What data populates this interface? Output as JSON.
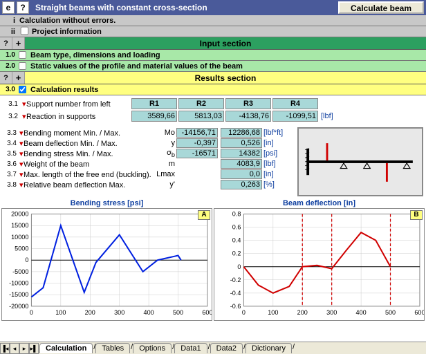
{
  "header": {
    "title": "Straight beams with constant cross-section",
    "calc_btn": "Calculate beam"
  },
  "info": {
    "i": "i",
    "i_text": "Calculation without errors.",
    "ii": "ii",
    "ii_text": "Project information"
  },
  "input_section": {
    "title": "Input section",
    "q": "?",
    "plus": "+"
  },
  "row10": {
    "num": "1.0",
    "text": "Beam type, dimensions and loading"
  },
  "row20": {
    "num": "2.0",
    "text": "Static values of the profile and material values of the beam"
  },
  "results_section": {
    "title": "Results section",
    "q": "?",
    "plus": "+"
  },
  "row30": {
    "num": "3.0",
    "text": "Calculation results"
  },
  "reactions": {
    "r31": "3.1",
    "r31_label": "Support number from left",
    "headers": [
      "R1",
      "R2",
      "R3",
      "R4"
    ],
    "r32": "3.2",
    "r32_label": "Reaction in supports",
    "values": [
      "3589,66",
      "5813,03",
      "-4138,76",
      "-1099,51"
    ],
    "unit": "[lbf]"
  },
  "calc": {
    "rows": [
      {
        "num": "3.3",
        "label": "Bending moment Min. / Max.",
        "sym": "Mo",
        "min": "-14156,71",
        "max": "12286,68",
        "unit": "[lbf*ft]"
      },
      {
        "num": "3.4",
        "label": "Beam deflection Min. / Max.",
        "sym": "y",
        "min": "-0,397",
        "max": "0,526",
        "unit": "[in]"
      },
      {
        "num": "3.5",
        "label": "Bending stress Min. / Max.",
        "sym": "σ<sub>b</sub>",
        "min": "-16571",
        "max": "14382",
        "unit": "[psi]"
      },
      {
        "num": "3.6",
        "label": "Weight of the beam",
        "sym": "m",
        "min": "",
        "max": "4083,9",
        "unit": "[lbf]"
      },
      {
        "num": "3.7",
        "label": "Max. length of the free end (buckling).",
        "sym": "Lmax",
        "min": "",
        "max": "0,0",
        "unit": "[in]"
      },
      {
        "num": "3.8",
        "label": "Relative beam deflection Max.",
        "sym": "y'",
        "min": "",
        "max": "0,263",
        "unit": "[%]"
      }
    ]
  },
  "chart_data": [
    {
      "type": "line",
      "title": "Bending stress  [psi]",
      "badge": "A",
      "xlim": [
        0,
        600
      ],
      "ylim": [
        -20000,
        20000
      ],
      "xticks": [
        0,
        100,
        200,
        300,
        400,
        500,
        600
      ],
      "yticks": [
        -20000,
        -15000,
        -10000,
        -5000,
        0,
        5000,
        10000,
        15000,
        20000
      ],
      "x": [
        0,
        40,
        100,
        180,
        220,
        300,
        380,
        430,
        500,
        510
      ],
      "y": [
        -16000,
        -12000,
        15000,
        -14000,
        -1000,
        11000,
        -5000,
        0,
        2000,
        0
      ],
      "color": "#0020e0"
    },
    {
      "type": "line",
      "title": "Beam deflection  [in]",
      "badge": "B",
      "xlim": [
        0,
        600
      ],
      "ylim": [
        -0.6,
        0.8
      ],
      "xticks": [
        0,
        100,
        200,
        300,
        400,
        500,
        600
      ],
      "yticks": [
        -0.6,
        -0.4,
        -0.2,
        0,
        0.2,
        0.4,
        0.6,
        0.8
      ],
      "x": [
        0,
        50,
        100,
        155,
        200,
        250,
        300,
        350,
        400,
        450,
        500
      ],
      "y": [
        0,
        -0.28,
        -0.4,
        -0.3,
        0,
        0.02,
        -0.03,
        0.25,
        0.52,
        0.4,
        0
      ],
      "vmarks": [
        200,
        300,
        500
      ],
      "color": "#d00000"
    }
  ],
  "tabs": {
    "items": [
      "Calculation",
      "Tables",
      "Options",
      "Data1",
      "Data2",
      "Dictionary"
    ],
    "active": 0
  }
}
